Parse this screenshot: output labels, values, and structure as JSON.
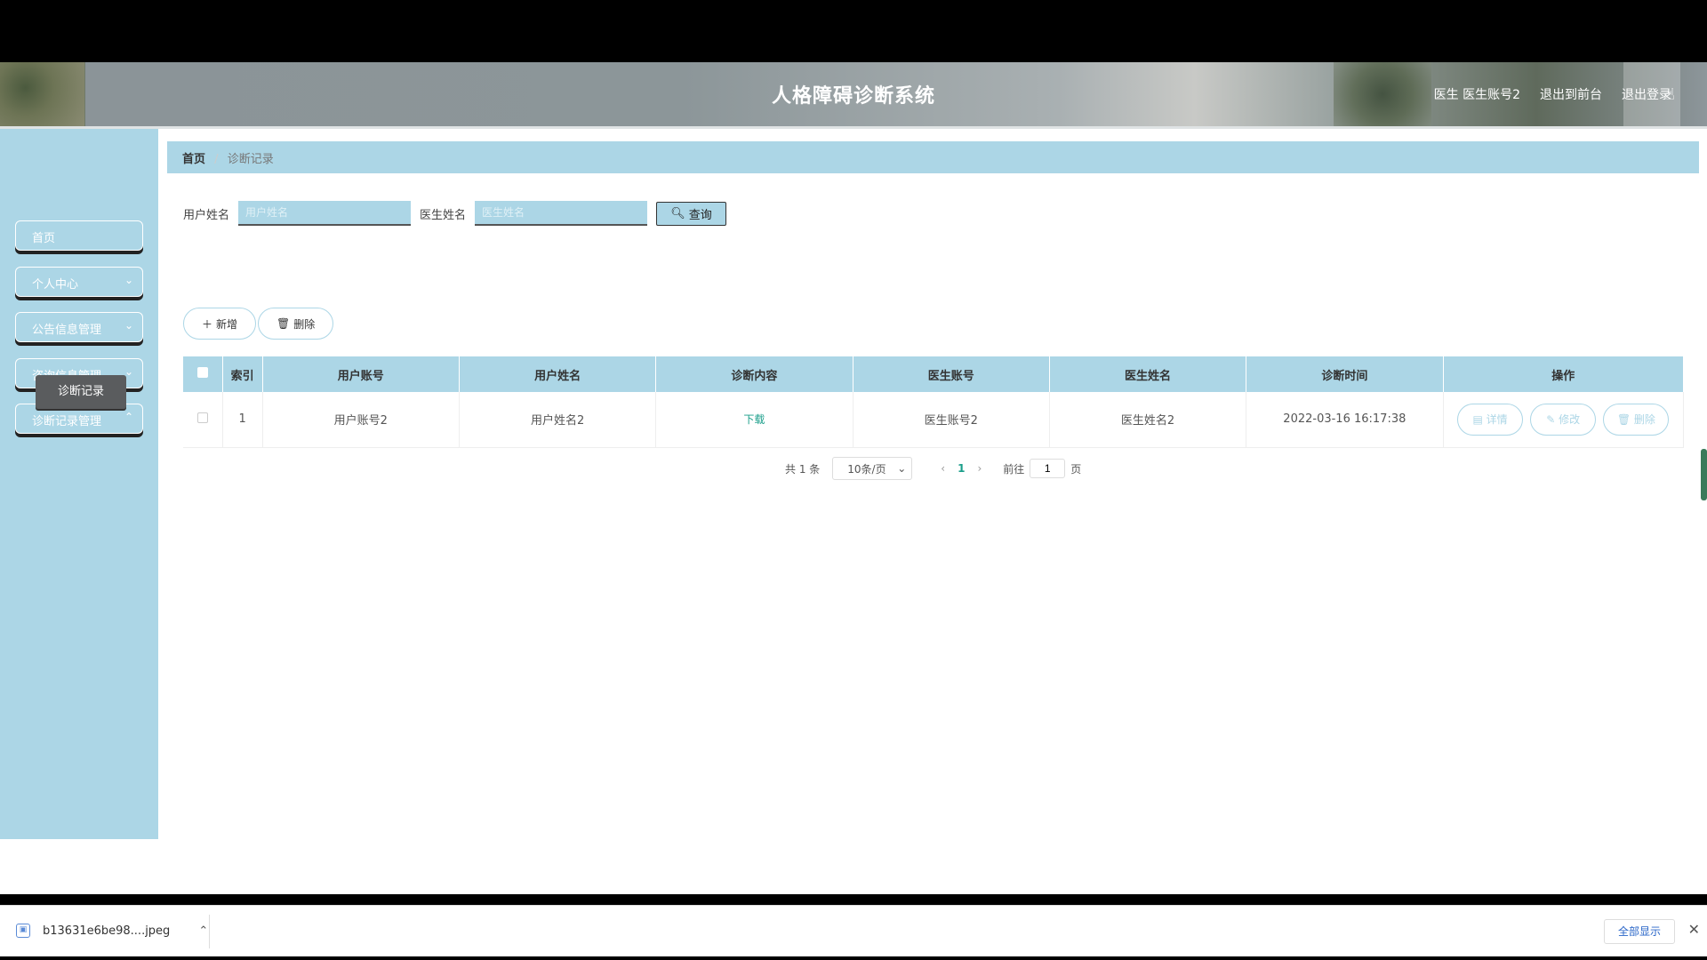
{
  "header": {
    "title": "人格障碍诊断系统",
    "user_label": "医生 医生账号2",
    "back_label": "退出到前台",
    "logout_label": "退出登录"
  },
  "sidebar": {
    "items": [
      {
        "label": "首页"
      },
      {
        "label": "个人中心"
      },
      {
        "label": "公告信息管理"
      },
      {
        "label": "咨询信息管理"
      },
      {
        "label": "诊断记录管理"
      }
    ],
    "submenu_active": "诊断记录"
  },
  "breadcrumb": {
    "home": "首页",
    "current": "诊断记录"
  },
  "search": {
    "user_name_label": "用户姓名",
    "user_name_placeholder": "用户姓名",
    "doctor_name_label": "医生姓名",
    "doctor_name_placeholder": "医生姓名",
    "query_label": "查询"
  },
  "actions": {
    "add_label": "新增",
    "delete_label": "删除"
  },
  "table": {
    "headers": [
      "索引",
      "用户账号",
      "用户姓名",
      "诊断内容",
      "医生账号",
      "医生姓名",
      "诊断时间",
      "操作"
    ],
    "rows": [
      {
        "index": "1",
        "user_account": "用户账号2",
        "user_name": "用户姓名2",
        "content": "下载",
        "doctor_account": "医生账号2",
        "doctor_name": "医生姓名2",
        "time": "2022-03-16 16:17:38",
        "detail_label": "详情",
        "edit_label": "修改",
        "delete_label": "删除"
      }
    ]
  },
  "pagination": {
    "total": "共 1 条",
    "page_size": "10条/页",
    "current_page": "1",
    "goto_label": "前往",
    "goto_value": "1",
    "page_suffix": "页"
  },
  "download_bar": {
    "file_name": "b13631e6be98....jpeg",
    "show_all_label": "全部显示"
  }
}
